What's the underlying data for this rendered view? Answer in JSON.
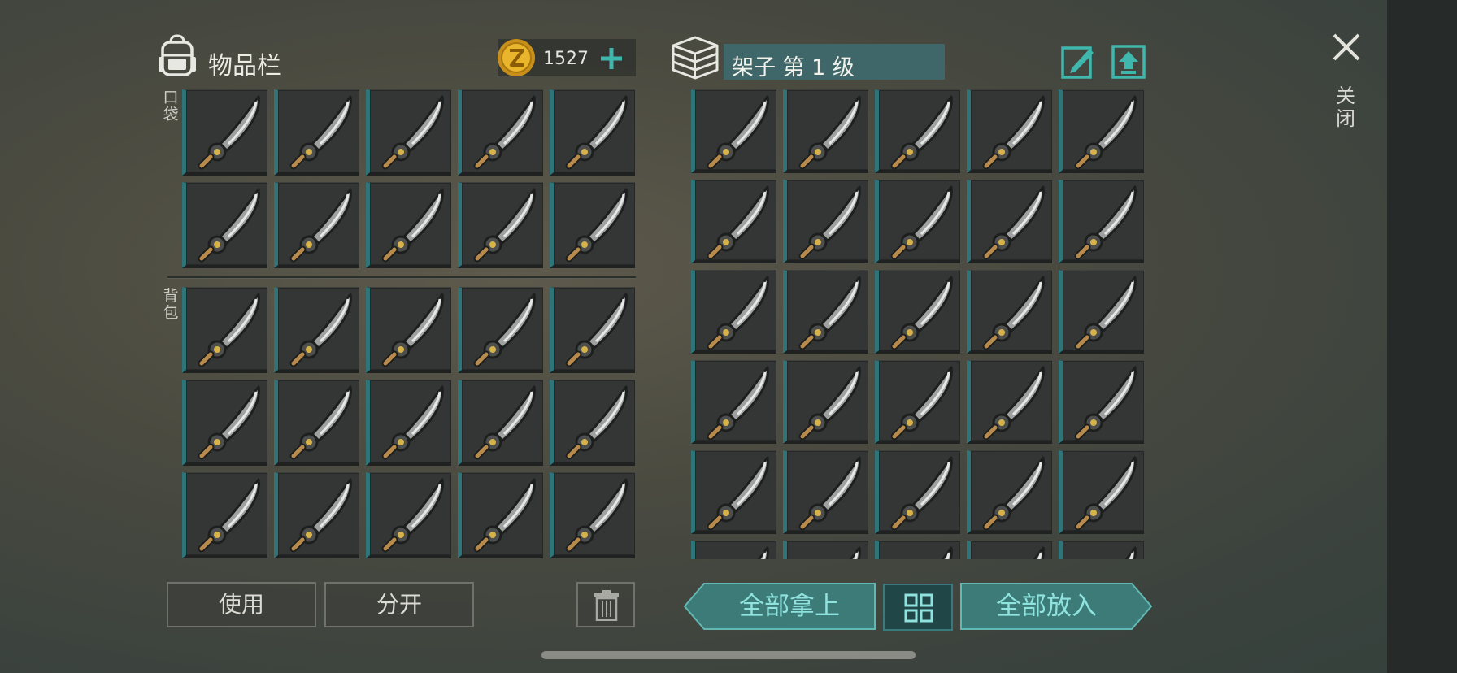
{
  "inventory": {
    "title": "物品栏",
    "coins": "1527",
    "pocket_label": "口袋",
    "backpack_label": "背包",
    "pocket_slots": 10,
    "backpack_slots": 15,
    "slot_item": "sword-icon"
  },
  "shelf": {
    "title": "架子 第 1 级",
    "visible_slots": 30,
    "slot_item": "sword-icon"
  },
  "close": {
    "label": "关闭"
  },
  "actions": {
    "use": "使用",
    "split": "分开",
    "take_all": "全部拿上",
    "put_all": "全部放入"
  },
  "icons": {
    "backpack": "backpack-icon",
    "coin": "coin-icon",
    "add": "plus-icon",
    "shelf": "shelf-icon",
    "rename": "edit-icon",
    "upgrade": "upgrade-icon",
    "close": "close-icon",
    "trash": "trash-icon",
    "sort": "grid-icon"
  },
  "colors": {
    "accent": "#2f7479",
    "teal_text": "#8fe3df",
    "coin": "#d9a521"
  }
}
